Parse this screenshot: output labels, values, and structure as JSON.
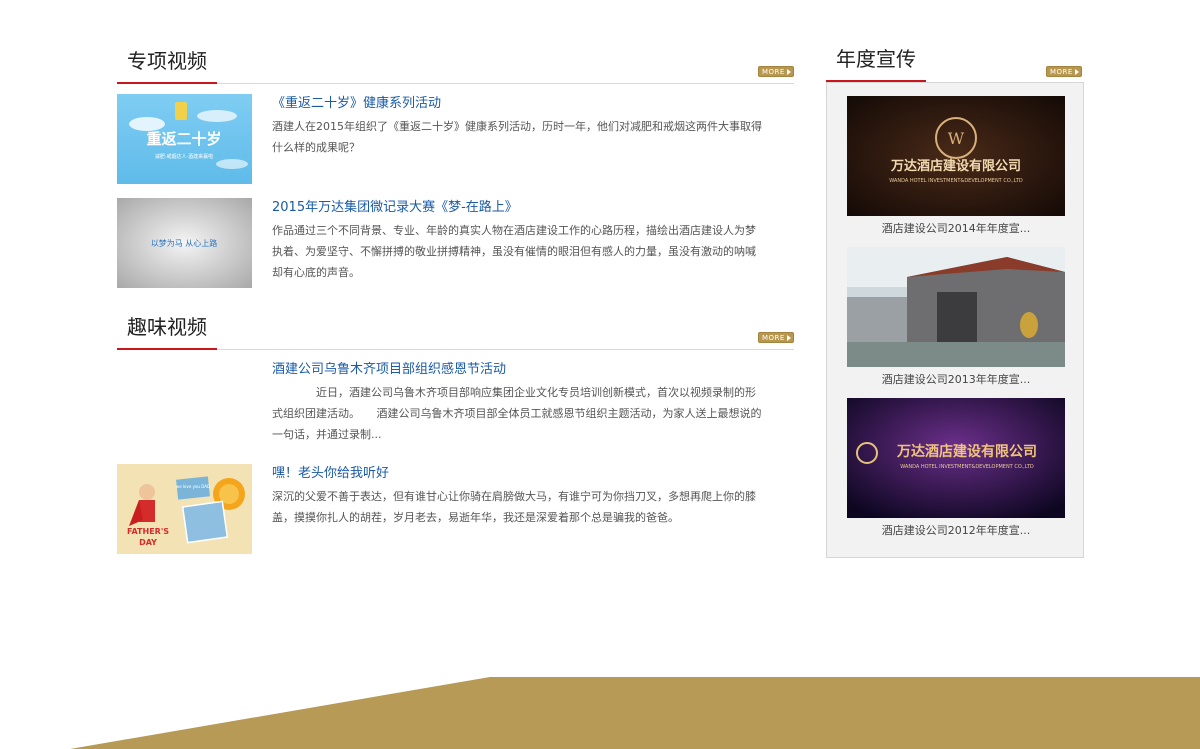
{
  "special_videos": {
    "title": "专项视频",
    "more_label": "MORE",
    "items": [
      {
        "title": "《重返二十岁》健康系列活动",
        "desc": "酒建人在2015年组织了《重返二十岁》健康系列活动，历时一年，他们对减肥和戒烟这两件大事取得什么样的成果呢？",
        "thumb_text": "重返二十岁",
        "thumb_sub": "减肥·戒烟达人·酒建来赢啦"
      },
      {
        "title": "2015年万达集团微记录大赛《梦-在路上》",
        "desc": "作品通过三个不同背景、专业、年龄的真实人物在酒店建设工作的心路历程，描绘出酒店建设人为梦执着、为爱坚守、不懈拼搏的敬业拼搏精神，虽没有催情的眼泪但有感人的力量，虽没有激动的呐喊却有心底的声音。",
        "thumb_text": "以梦为马  从心上路"
      }
    ]
  },
  "fun_videos": {
    "title": "趣味视频",
    "more_label": "MORE",
    "items": [
      {
        "title": "酒建公司乌鲁木齐项目部组织感恩节活动",
        "desc": "近日，酒建公司乌鲁木齐项目部响应集团企业文化专员培训创新模式，首次以视频录制的形式组织团建活动。　　酒建公司乌鲁木齐项目部全体员工就感恩节组织主题活动，为家人送上最想说的一句话，并通过录制..."
      },
      {
        "title": "嘿！老头你给我听好",
        "desc": "深沉的父爱不善于表达，但有谁甘心让你骑在肩膀做大马，有谁宁可为你挡刀叉，多想再爬上你的膝盖，摸摸你扎人的胡茬，岁月老去，易逝年华，我还是深爱着那个总是骗我的爸爸。",
        "thumb_line1": "FATHER'S",
        "thumb_line2": "DAY",
        "thumb_note": "we love you DAD"
      }
    ]
  },
  "annual_promo": {
    "title": "年度宣传",
    "more_label": "MORE",
    "items": [
      {
        "caption": "酒店建设公司2014年年度宣...",
        "img_title": "万达酒店建设有限公司",
        "img_sub": "WANDA HOTEL INVESTMENT&DEVELOPMENT CO.,LTD"
      },
      {
        "caption": "酒店建设公司2013年年度宣..."
      },
      {
        "caption": "酒店建设公司2012年年度宣...",
        "img_title": "万达酒店建设有限公司",
        "img_sub": "WANDA HOTEL INVESTMENT&DEVELOPMENT CO.,LTD"
      }
    ]
  },
  "colors": {
    "accent_red": "#c8161d",
    "link_blue": "#1a5aa6",
    "gold": "#b8974f"
  }
}
